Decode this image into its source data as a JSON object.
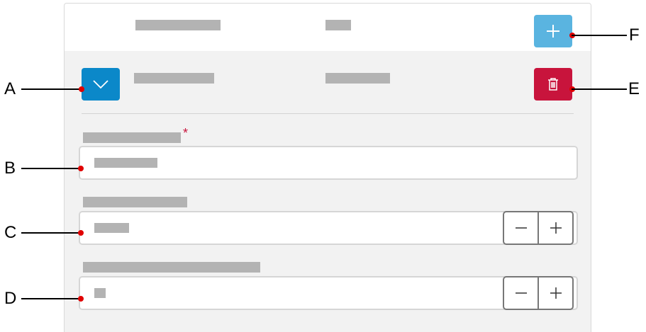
{
  "form": {
    "required_marker": "*"
  },
  "callouts": {
    "a": "A",
    "b": "B",
    "c": "C",
    "d": "D",
    "e": "E",
    "f": "F"
  },
  "icons": {
    "add": "plus-icon",
    "expand": "chevron-down-icon",
    "delete": "trash-icon",
    "decrement": "minus-icon",
    "increment": "plus-icon"
  },
  "colors": {
    "add_button": "#5ab4e0",
    "expand_button": "#0b88c9",
    "delete_button": "#c8143c",
    "callout_dot": "#e00000"
  }
}
